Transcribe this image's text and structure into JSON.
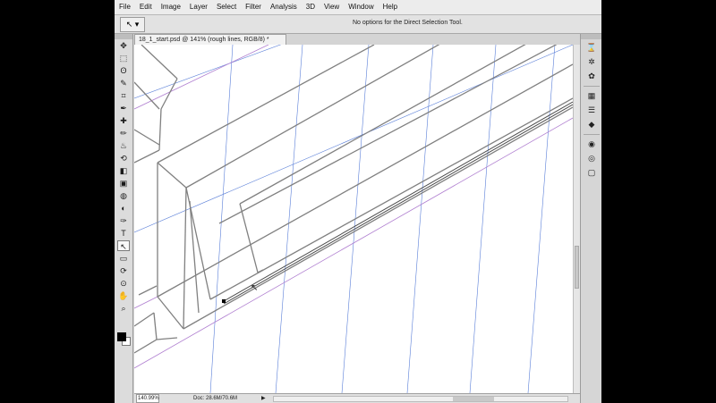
{
  "menu": [
    "File",
    "Edit",
    "Image",
    "Layer",
    "Select",
    "Filter",
    "Analysis",
    "3D",
    "View",
    "Window",
    "Help"
  ],
  "options_bar": {
    "tool_icon": "direct-selection-icon",
    "text": "No options for the Direct Selection Tool."
  },
  "document_tab": {
    "title": "18_1_start.psd @ 141% (rough lines, RGB/8) *",
    "close": "×"
  },
  "tools": [
    "move-icon",
    "marquee-icon",
    "lasso-icon",
    "quick-select-icon",
    "crop-icon",
    "eyedropper-icon",
    "healing-icon",
    "brush-icon",
    "clone-stamp-icon",
    "history-brush-icon",
    "eraser-icon",
    "gradient-icon",
    "blur-icon",
    "dodge-icon",
    "pen-icon",
    "type-icon",
    "direct-selection-icon",
    "shape-icon",
    "3d-rotate-icon",
    "3d-orbit-icon",
    "hand-icon",
    "zoom-icon"
  ],
  "tool_glyphs": [
    "✥",
    "⬚",
    "ʘ",
    "✎",
    "⌗",
    "✒",
    "✚",
    "✏",
    "♨",
    "⟲",
    "◧",
    "▣",
    "◍",
    "◐",
    "✑",
    "T",
    "↖",
    "▭",
    "⟳",
    "⊙",
    "✋",
    "⌕"
  ],
  "selected_tool": "direct-selection-icon",
  "colors": {
    "foreground": "#000000",
    "background": "#ffffff",
    "guide": "#5a7fd8",
    "path": "#b07fd0"
  },
  "status": {
    "zoom": "140.99%",
    "doc": "Doc: 28.6M/70.6M",
    "arrow": "▶"
  },
  "panel_icons": [
    "history-icon",
    "actions-icon",
    "brushes-icon",
    "layers-icon",
    "channels-icon",
    "paths-icon",
    "styles-icon",
    "adjustments-icon",
    "masks-icon"
  ],
  "panel_glyphs": [
    "⌛",
    "✲",
    "✿",
    "▦",
    "☰",
    "◆",
    "◉",
    "◎",
    "▢"
  ],
  "window_controls": [
    "×"
  ]
}
